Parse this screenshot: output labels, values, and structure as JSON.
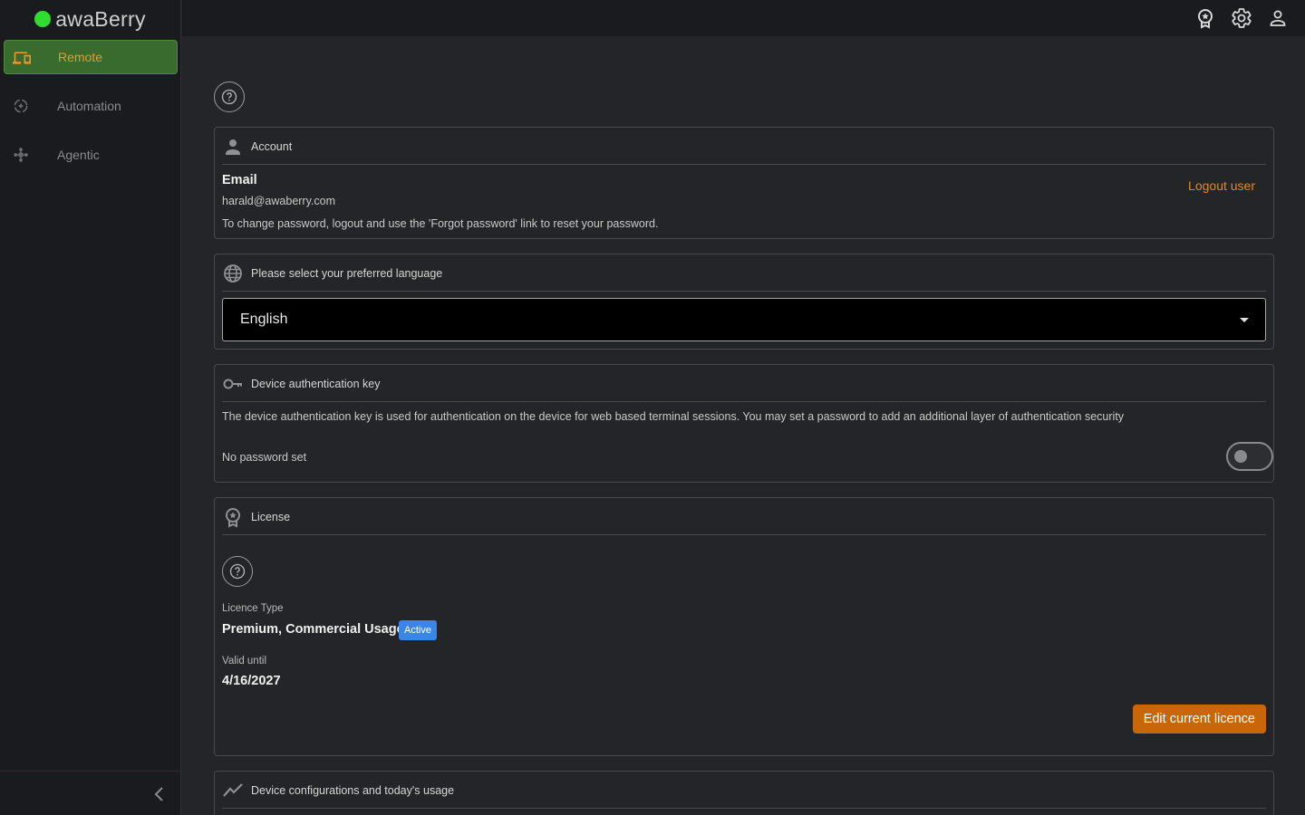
{
  "brand": {
    "name": "awaBerry",
    "dot_color": "#2fdc2f"
  },
  "sidebar": {
    "items": [
      {
        "label": "Remote",
        "icon": "devices-icon",
        "active": true
      },
      {
        "label": "Automation",
        "icon": "automation-icon",
        "active": false
      },
      {
        "label": "Agentic",
        "icon": "agentic-icon",
        "active": false
      }
    ],
    "collapse_icon": "chevron-left-icon"
  },
  "topbar": {
    "icons": [
      "licence-icon",
      "settings-icon",
      "user-icon"
    ]
  },
  "account": {
    "title": "Account",
    "email_label": "Email",
    "email_value": "harald@awaberry.com",
    "hint": "To change password, logout and use the 'Forgot password' link to reset your password.",
    "logout_label": "Logout user"
  },
  "language": {
    "title": "Please select your preferred language",
    "selected": "English"
  },
  "device_auth": {
    "title": "Device authentication key",
    "description": "The device authentication key is used for authentication on the device for web based terminal sessions. You may set a password to add an additional layer of authentication security",
    "status": "No password set",
    "toggle_on": false
  },
  "license": {
    "title": "License",
    "type_label": "Licence Type",
    "type_value": "Premium, Commercial Usage",
    "status_badge": "Active",
    "valid_label": "Valid until",
    "valid_value": "4/16/2027",
    "edit_button": "Edit current licence"
  },
  "usage": {
    "title": "Device configurations and today's usage"
  },
  "colors": {
    "accent_orange": "#e38a1f",
    "active_nav_bg": "#3a6b2e",
    "badge_blue": "#3a86e8",
    "button_orange": "#c8670a"
  }
}
